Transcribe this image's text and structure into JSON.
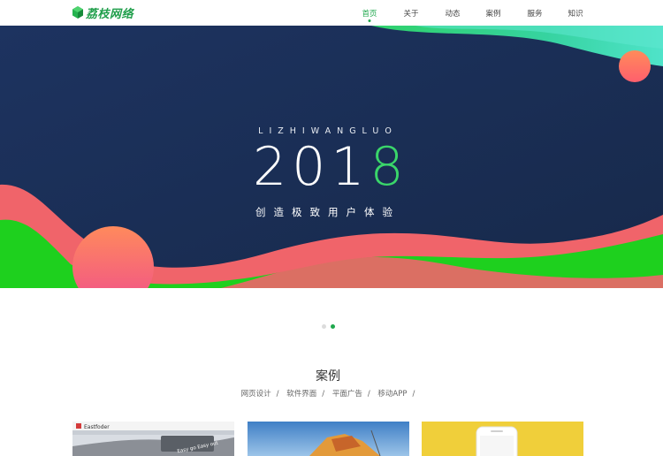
{
  "header": {
    "logo_text": "荔枝网络",
    "nav": [
      {
        "label": "首页",
        "active": true
      },
      {
        "label": "关于",
        "active": false
      },
      {
        "label": "动态",
        "active": false
      },
      {
        "label": "案例",
        "active": false
      },
      {
        "label": "服务",
        "active": false
      },
      {
        "label": "知识",
        "active": false
      }
    ]
  },
  "banner": {
    "subtitle": "LIZHIWANGLUO",
    "year_main": "201",
    "year_accent": "8",
    "slogan": "创造极致用户体验"
  },
  "carousel": {
    "count": 2,
    "active": 1
  },
  "cases": {
    "title": "案例",
    "categories": [
      "网页设计",
      "软件界面",
      "平面广告",
      "移动APP"
    ],
    "separator": "/",
    "thumb1_brand": "Eastfoder",
    "thumb1_tagline": "Easy go Easy out"
  },
  "colors": {
    "accent": "#1fa84d",
    "banner_bg": "#1d3054",
    "coral": "#f0646a",
    "green": "#1ed01e"
  }
}
